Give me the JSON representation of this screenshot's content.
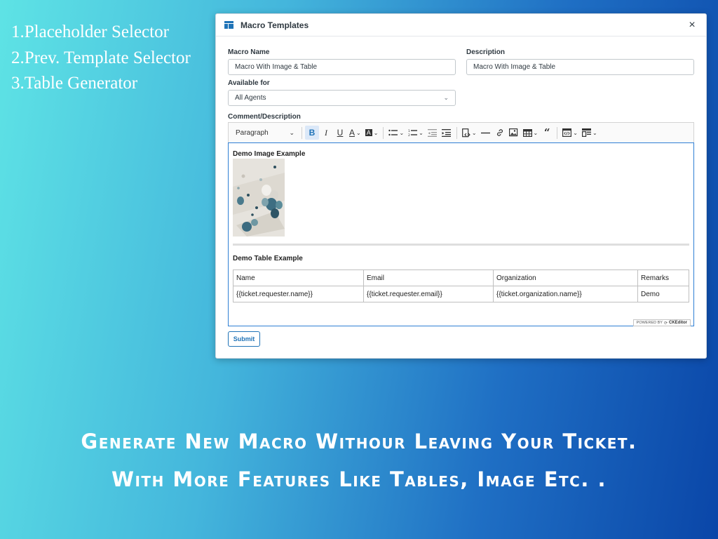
{
  "features": [
    "1.Placeholder Selector",
    "2.Prev. Template Selector",
    "3.Table Generator"
  ],
  "dialog": {
    "title": "Macro Templates",
    "close": "×",
    "macro_name_label": "Macro Name",
    "macro_name_value": "Macro With Image & Table",
    "description_label": "Description",
    "description_value": "Macro With Image & Table",
    "available_label": "Available for",
    "available_value": "All Agents",
    "comment_label": "Comment/Description",
    "submit": "Submit"
  },
  "toolbar": {
    "paragraph": "Paragraph",
    "icons": [
      "bold-icon",
      "italic-icon",
      "underline-icon",
      "font-color-icon",
      "font-background-icon",
      "bulleted-list-icon",
      "numbered-list-icon",
      "outdent-icon",
      "indent-icon",
      "insert-placeholder-icon",
      "horizontal-line-icon",
      "link-icon",
      "insert-image-icon",
      "insert-table-icon",
      "block-quote-icon",
      "source-editing-icon",
      "insert-template-icon"
    ]
  },
  "editor": {
    "image_heading": "Demo Image Example",
    "table_heading": "Demo Table Example",
    "table": {
      "headers": [
        "Name",
        "Email",
        "Organization",
        "Remarks"
      ],
      "rows": [
        [
          "{{ticket.requester.name}}",
          "{{ticket.requester.email}}",
          "{{ticket.organization.name}}",
          "Demo"
        ]
      ]
    },
    "badge_prefix": "POWERED BY",
    "badge_brand": "CKEditor"
  },
  "tagline": {
    "line1": "Generate New Macro Withour Leaving Your Ticket.",
    "line2": "With More Features Like Tables, Image Etc. ."
  },
  "colors": {
    "accent": "#1f73b7",
    "editor_focus": "#2f7fd4",
    "bg_start": "#5ee3e5",
    "bg_end": "#0a46a8"
  }
}
